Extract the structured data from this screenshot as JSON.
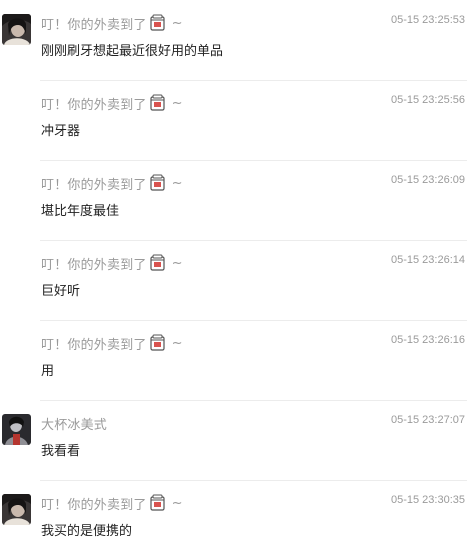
{
  "messages": [
    {
      "sender": "叮！你的外卖到了",
      "suffix": "~",
      "avatar": "dark-girl-avatar",
      "time": "05-15 23:25:53",
      "content": "刚刚刷牙想起最近很好用的单品"
    },
    {
      "sender": "叮！你的外卖到了",
      "suffix": "~",
      "avatar": "",
      "time": "05-15 23:25:56",
      "content": "冲牙器"
    },
    {
      "sender": "叮！你的外卖到了",
      "suffix": "~",
      "avatar": "",
      "time": "05-15 23:26:09",
      "content": "堪比年度最佳"
    },
    {
      "sender": "叮！你的外卖到了",
      "suffix": "~",
      "avatar": "",
      "time": "05-15 23:26:14",
      "content": "巨好听"
    },
    {
      "sender": "叮！你的外卖到了",
      "suffix": "~",
      "avatar": "",
      "time": "05-15 23:26:16",
      "content": "用"
    },
    {
      "sender": "大杯冰美式",
      "suffix": "",
      "avatar": "dark-figure-avatar",
      "time": "05-15 23:27:07",
      "content": "我看看"
    },
    {
      "sender": "叮！你的外卖到了",
      "suffix": "~",
      "avatar": "dark-girl-avatar",
      "time": "05-15 23:30:35",
      "content": "我买的是便携的"
    }
  ],
  "icons": {
    "name_emoji": "takeout-cup-icon"
  },
  "colors": {
    "name": "#9a9a9a",
    "time": "#9a9a9a",
    "content": "#222222",
    "divider": "#ececec",
    "emoji_red": "#d9534f"
  }
}
